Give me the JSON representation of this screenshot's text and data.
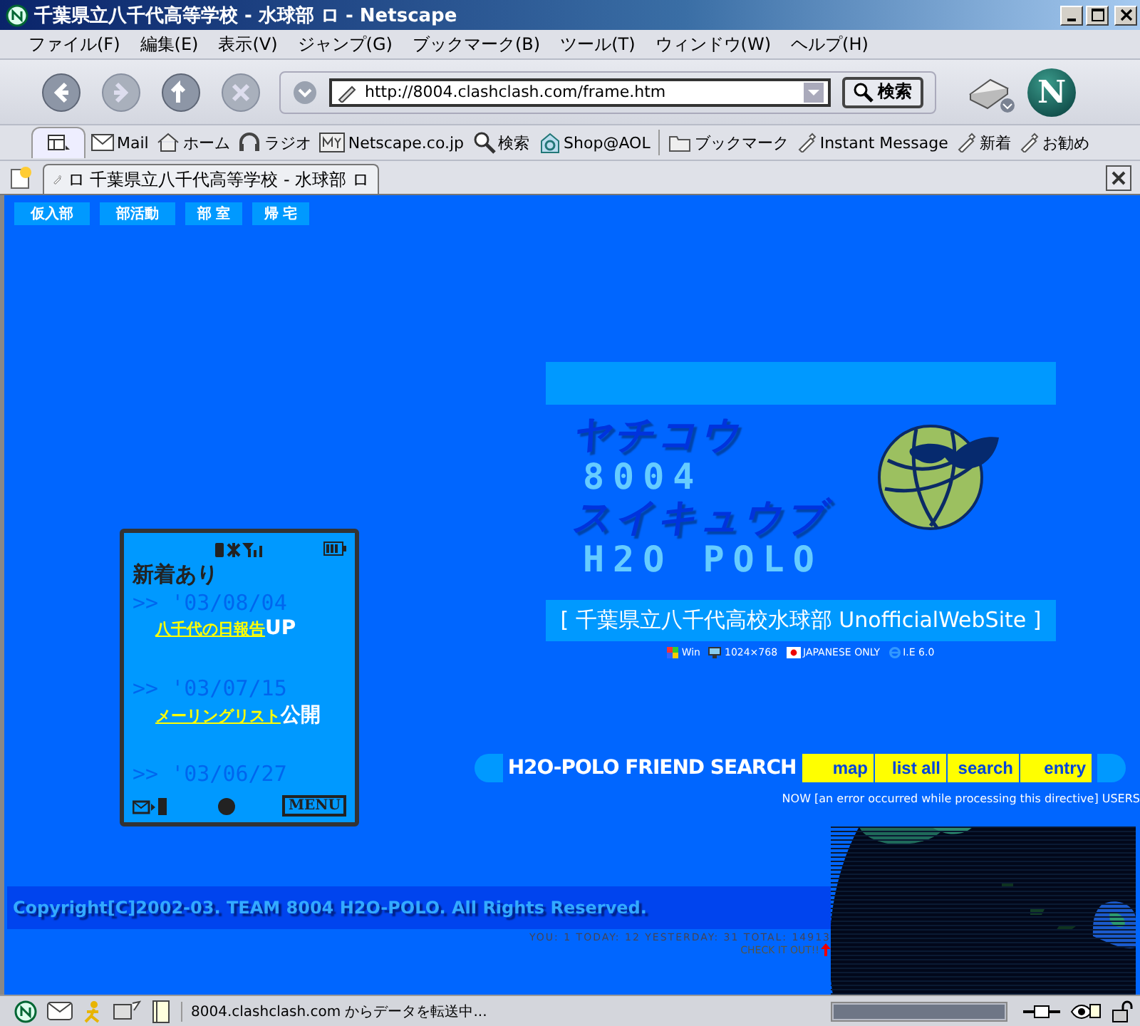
{
  "window": {
    "title": "千葉県立八千代高等学校 - 水球部 ロ - Netscape"
  },
  "menu": [
    "ファイル(F)",
    "編集(E)",
    "表示(V)",
    "ジャンプ(G)",
    "ブックマーク(B)",
    "ツール(T)",
    "ウィンドウ(W)",
    "ヘルプ(H)"
  ],
  "navigation": {
    "url": "http://8004.clashclash.com/frame.htm",
    "search_button": "検索",
    "brand_mark": "N"
  },
  "personal_toolbar": [
    {
      "label": "Mail",
      "kind": "mail"
    },
    {
      "label": "ホーム",
      "kind": "home"
    },
    {
      "label": "ラジオ",
      "kind": "radio"
    },
    {
      "label": "Netscape.co.jp",
      "kind": "my"
    },
    {
      "label": "検索",
      "kind": "search"
    },
    {
      "label": "Shop@AOL",
      "kind": "shop"
    },
    {
      "label": "ブックマーク",
      "kind": "folder"
    },
    {
      "label": "Instant Message",
      "kind": "link"
    },
    {
      "label": "新着",
      "kind": "link"
    },
    {
      "label": "お勧め",
      "kind": "link"
    }
  ],
  "tabs": [
    {
      "label": "ロ 千葉県立八千代高等学校 - 水球部 ロ",
      "selected": true
    }
  ],
  "page": {
    "nav": [
      "仮入部",
      "部活動",
      "部 室",
      "帰 宅"
    ],
    "phone": {
      "heading": "新着あり",
      "menu_key": "MENU",
      "entries": [
        {
          "date": ">> '03/08/04",
          "link": "八千代の日報告",
          "suffix": "UP"
        },
        {
          "date": ">> '03/07/15",
          "link": "メーリングリスト",
          "suffix": "公開"
        },
        {
          "date": ">> '03/06/27"
        }
      ]
    },
    "logo": {
      "line_1": "ヤチコウ",
      "line_2": "8004",
      "line_3": "スイキュウブ",
      "line_4": "H2O POLO"
    },
    "subtitle": "[ 千葉県立八千代高校水球部 UnofficialWebSite ]",
    "specs": [
      {
        "label": "Win",
        "kind": "windows"
      },
      {
        "label": "1024×768",
        "kind": "monitor"
      },
      {
        "label": "JAPANESE ONLY",
        "kind": "flag"
      },
      {
        "label": "I.E 6.0",
        "kind": "browser"
      }
    ],
    "friend_search": {
      "title": "H2O-POLO FRIEND SEARCH",
      "buttons": [
        "map",
        "list all",
        "search",
        "entry"
      ],
      "users_line": "NOW [an error occurred while processing this directive] USERS"
    },
    "copyright": "Copyright[C]2002-03. TEAM 8004 H2O-POLO. All Rights Reserved.",
    "counter": "YOU: 1 TODAY: 12 YESTERDAY: 31 TOTAL: 14913",
    "check": "CHECK IT OUT!!"
  },
  "status_bar": {
    "text": "8004.clashclash.com からデータを転送中...",
    "progress": {
      "level": 1
    }
  }
}
